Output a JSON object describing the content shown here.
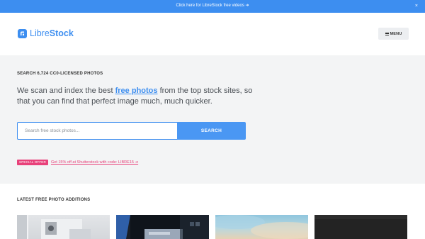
{
  "announcement": {
    "text": "Click here for LibreStock free videos ➔",
    "close": "×"
  },
  "header": {
    "logo_part1": "Libre",
    "logo_part2": "Stock",
    "menu_label": "MENU"
  },
  "hero": {
    "eyebrow": "SEARCH 6,724 CC0-LICENSED PHOTOS",
    "lead_before": "We scan and index the best ",
    "lead_highlight": "free photos",
    "lead_after": " from the top stock sites, so that you can find that perfect image much, much quicker.",
    "search_placeholder": "Search free stock photos...",
    "search_button": "SEARCH",
    "offer_badge": "SPECIAL OFFER",
    "offer_text": "Get 15% off at Shutterstock with code: LIBRE15 ➔"
  },
  "latest": {
    "title": "LATEST FREE PHOTO ADDITIONS"
  },
  "colors": {
    "brand": "#3d8ef0",
    "offer": "#e8417a",
    "hero_bg": "#f3f4f5"
  }
}
